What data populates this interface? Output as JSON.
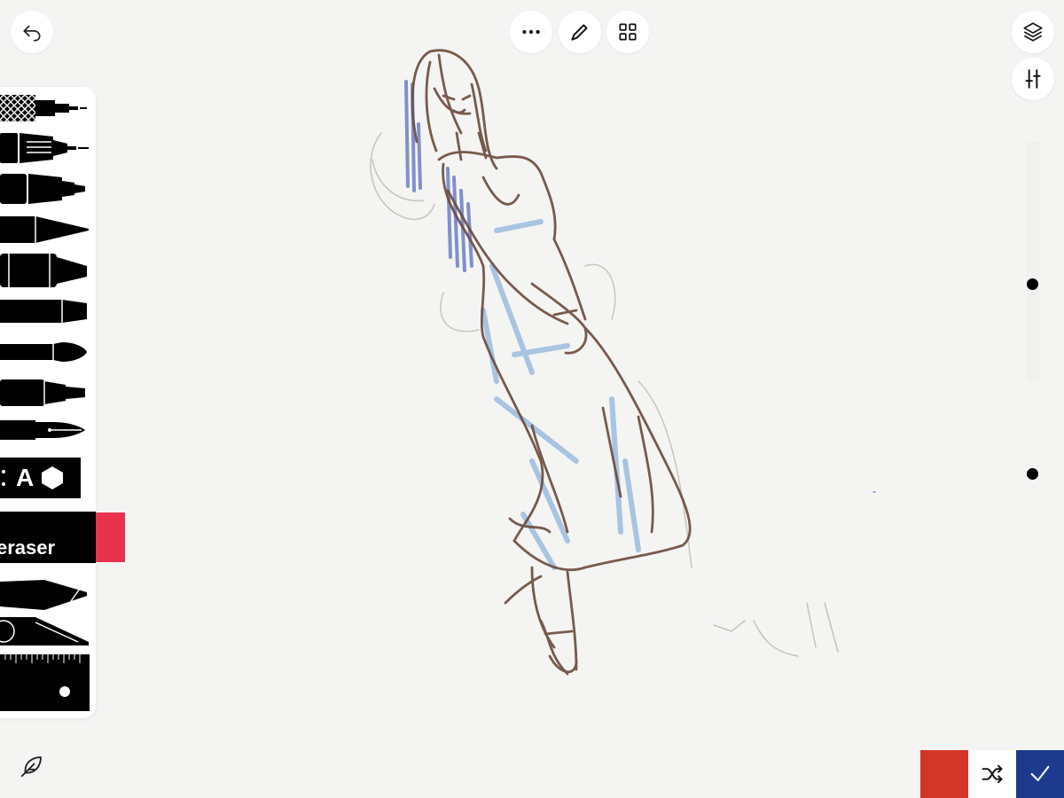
{
  "top_bar": {
    "undo_icon": "undo-arrow-icon",
    "more_icon": "ellipsis-icon",
    "pen_icon": "pencil-icon",
    "grid_icon": "grid-icon",
    "layers_icon": "layers-icon",
    "adjust_icon": "sliders-icon"
  },
  "toolbox": {
    "tools": [
      {
        "name": "crosshatch-pen",
        "icon": "crosshatch-pen-icon"
      },
      {
        "name": "technical-pen",
        "icon": "technical-pen-icon"
      },
      {
        "name": "marker",
        "icon": "marker-icon"
      },
      {
        "name": "pencil",
        "icon": "pencil-tool-icon"
      },
      {
        "name": "chisel-marker",
        "icon": "chisel-marker-icon"
      },
      {
        "name": "felt-tip",
        "icon": "felt-tip-icon"
      },
      {
        "name": "brush",
        "icon": "brush-icon"
      },
      {
        "name": "fineliner",
        "icon": "fineliner-icon"
      },
      {
        "name": "fountain-pen",
        "icon": "fountain-pen-icon"
      }
    ],
    "text_tool": {
      "letter": "A",
      "icon": "text-shapes-icon"
    },
    "eraser_label": "eraser",
    "eraser_accent_color": "#e8334f",
    "lower_tools": [
      "smudge-icon",
      "cut-fill-icon"
    ],
    "ruler_icon": "ruler-icon"
  },
  "canvas": {
    "background": "#f4f4f3",
    "sketch_line_color": "#6a4a3a",
    "sketch_blue_color": "#8fb4dc",
    "sketch_purple_color": "#5b6fc0"
  },
  "right_rail": {
    "slider_dots": 2
  },
  "bottom_bar": {
    "feather_icon": "feather-icon",
    "current_color": "#d33528",
    "shuffle_icon": "shuffle-icon",
    "confirm_icon": "checkmark-icon"
  }
}
